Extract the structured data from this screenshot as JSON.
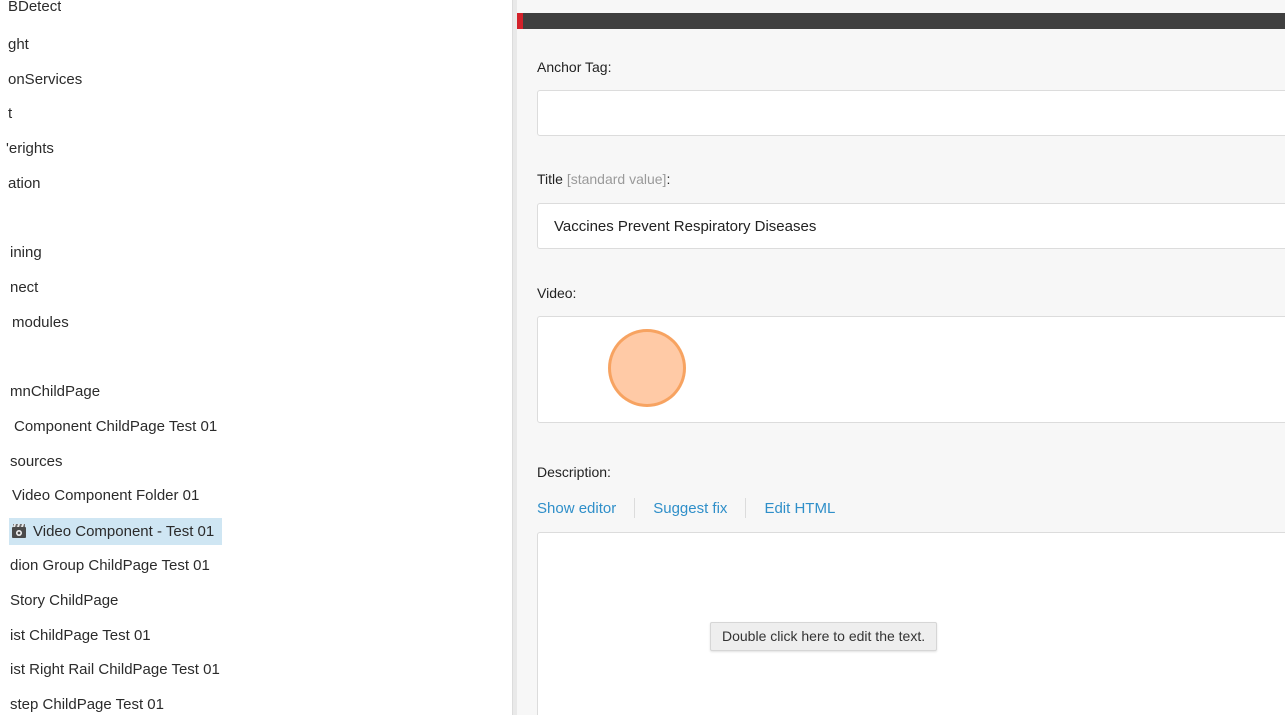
{
  "tree": {
    "items": [
      {
        "label": "BDetect"
      },
      {
        "label": "ght"
      },
      {
        "label": "onServices"
      },
      {
        "label": "t"
      },
      {
        "label": "'erights"
      },
      {
        "label": "ation"
      },
      {
        "label": "ining"
      },
      {
        "label": "nect"
      },
      {
        "label": "modules"
      },
      {
        "label": "mnChildPage"
      },
      {
        "label": "Component ChildPage Test 01"
      },
      {
        "label": "sources"
      },
      {
        "label": "Video Component Folder 01"
      },
      {
        "label": "Video Component - Test 01",
        "icon": "video-component-icon",
        "selected": true
      },
      {
        "label": "dion Group ChildPage Test 01"
      },
      {
        "label": "Story ChildPage"
      },
      {
        "label": "ist ChildPage Test 01"
      },
      {
        "label": "ist Right Rail ChildPage Test 01"
      },
      {
        "label": "step ChildPage Test 01"
      }
    ]
  },
  "editor": {
    "accent_color": "#d3212a",
    "bar_color": "#3f3f3f",
    "fields": {
      "anchor_tag": {
        "label": "Anchor Tag:",
        "value": ""
      },
      "title": {
        "label": "Title",
        "standard_value_note": "[standard value]",
        "suffix": ":",
        "value": "Vaccines Prevent Respiratory Diseases"
      },
      "video": {
        "label": "Video:"
      },
      "description": {
        "label": "Description:"
      }
    },
    "description_links": {
      "show_editor": "Show editor",
      "suggest_fix": "Suggest fix",
      "edit_html": "Edit HTML"
    },
    "rte_hint": "Double click here to edit the text."
  }
}
